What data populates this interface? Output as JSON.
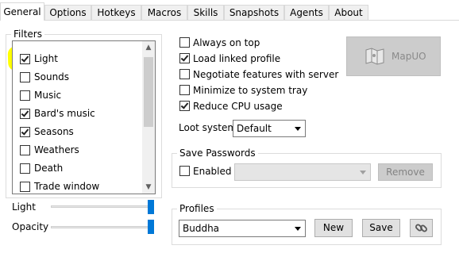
{
  "tabs": [
    "General",
    "Options",
    "Hotkeys",
    "Macros",
    "Skills",
    "Snapshots",
    "Agents",
    "About"
  ],
  "active_tab": "General",
  "filters": {
    "title": "Filters",
    "items": [
      {
        "label": "Light",
        "checked": true
      },
      {
        "label": "Sounds",
        "checked": false
      },
      {
        "label": "Music",
        "checked": false
      },
      {
        "label": "Bard's music",
        "checked": true
      },
      {
        "label": "Seasons",
        "checked": true
      },
      {
        "label": "Weathers",
        "checked": false
      },
      {
        "label": "Death",
        "checked": false
      },
      {
        "label": "Trade window",
        "checked": false
      }
    ]
  },
  "sliders": {
    "light": {
      "label": "Light",
      "value": 1.0
    },
    "opacity": {
      "label": "Opacity",
      "value": 1.0
    }
  },
  "options": [
    {
      "label": "Always on top",
      "checked": false
    },
    {
      "label": "Load linked profile",
      "checked": true
    },
    {
      "label": "Negotiate features with server",
      "checked": false
    },
    {
      "label": "Minimize to system tray",
      "checked": false
    },
    {
      "label": "Reduce CPU usage",
      "checked": true
    }
  ],
  "mapuo_button": {
    "label": "MapUO",
    "icon": "map-icon",
    "enabled": false
  },
  "loot_system": {
    "label": "Loot system",
    "value": "Default"
  },
  "save_passwords": {
    "title": "Save Passwords",
    "enabled_label": "Enabled",
    "enabled_checked": false,
    "account_value": "",
    "remove_label": "Remove"
  },
  "profiles": {
    "title": "Profiles",
    "selected": "Buddha",
    "new_label": "New",
    "save_label": "Save",
    "link_icon": "link-icon"
  },
  "colors": {
    "highlight": "#ffff00",
    "slider_thumb": "#0078d7"
  }
}
